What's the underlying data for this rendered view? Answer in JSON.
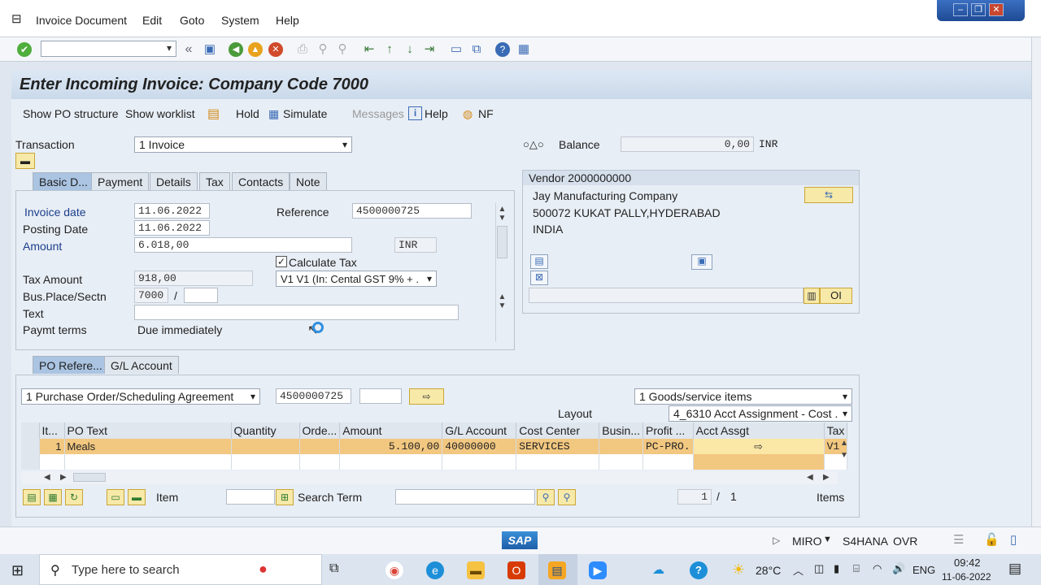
{
  "menu": {
    "items": [
      "Invoice Document",
      "Edit",
      "Goto",
      "System",
      "Help"
    ]
  },
  "window": {
    "title": "Enter Incoming Invoice: Company Code 7000"
  },
  "app_toolbar": {
    "show_po_structure": "Show PO structure",
    "show_worklist": "Show worklist",
    "hold": "Hold",
    "simulate": "Simulate",
    "messages": "Messages",
    "help": "Help",
    "nf": "NF"
  },
  "header": {
    "transaction_label": "Transaction",
    "transaction_value": "1 Invoice",
    "balance_label": "Balance",
    "balance_value": "0,00",
    "balance_currency": "INR"
  },
  "tabs": [
    "Basic D...",
    "Payment",
    "Details",
    "Tax",
    "Contacts",
    "Note"
  ],
  "basic_data": {
    "invoice_date_label": "Invoice date",
    "invoice_date": "11.06.2022",
    "posting_date_label": "Posting Date",
    "posting_date": "11.06.2022",
    "reference_label": "Reference",
    "reference": "4500000725",
    "amount_label": "Amount",
    "amount": "6.018,00",
    "currency": "INR",
    "calculate_tax_label": "Calculate Tax",
    "calculate_tax_checked": true,
    "tax_amount_label": "Tax Amount",
    "tax_amount": "918,00",
    "tax_code": "V1 V1 (In: Cental GST 9% + .",
    "bus_place_label": "Bus.Place/Sectn",
    "bus_place": "7000",
    "bus_sep": "/",
    "text_label": "Text",
    "paymt_terms_label": "Paymt terms",
    "paymt_terms": "Due immediately"
  },
  "vendor": {
    "header": "Vendor 2000000000",
    "name": "Jay Manufacturing Company",
    "address": "500072 KUKAT PALLY,HYDERABAD",
    "country": "INDIA",
    "oi_label": "OI"
  },
  "po_tabs": [
    "PO Refere...",
    "G/L Account"
  ],
  "po_ref": {
    "doc_type": "1 Purchase Order/Scheduling Agreement",
    "po_number": "4500000725",
    "items_select": "1 Goods/service items",
    "layout_label": "Layout",
    "layout_value": "4_6310 Acct Assignment - Cost ."
  },
  "grid": {
    "columns": [
      "It...",
      "PO Text",
      "Quantity",
      "Orde...",
      "Amount",
      "G/L Account",
      "Cost Center",
      "Busin...",
      "Profit ...",
      "Acct Assgt",
      "Tax"
    ],
    "rows": [
      [
        "1",
        "Meals",
        "",
        "",
        "5.100,00",
        "40000000",
        "SERVICES",
        "",
        "PC-PRO.",
        "",
        "V1"
      ]
    ]
  },
  "grid_footer": {
    "item_label": "Item",
    "search_term_label": "Search Term",
    "page_current": "1",
    "page_sep": "/",
    "page_total": "1",
    "items_label": "Items"
  },
  "status": {
    "mode": "MIRO",
    "system": "S4HANA",
    "ovr": "OVR",
    "logo": "SAP"
  },
  "taskbar": {
    "search_placeholder": "Type here to search",
    "temperature": "28°C",
    "lang": "ENG",
    "time": "09:42",
    "date": "11-06-2022"
  },
  "colors": {
    "selected_row": "#f2c780",
    "title_bg": "#cad9ea",
    "tab_active": "#aac4e2"
  }
}
